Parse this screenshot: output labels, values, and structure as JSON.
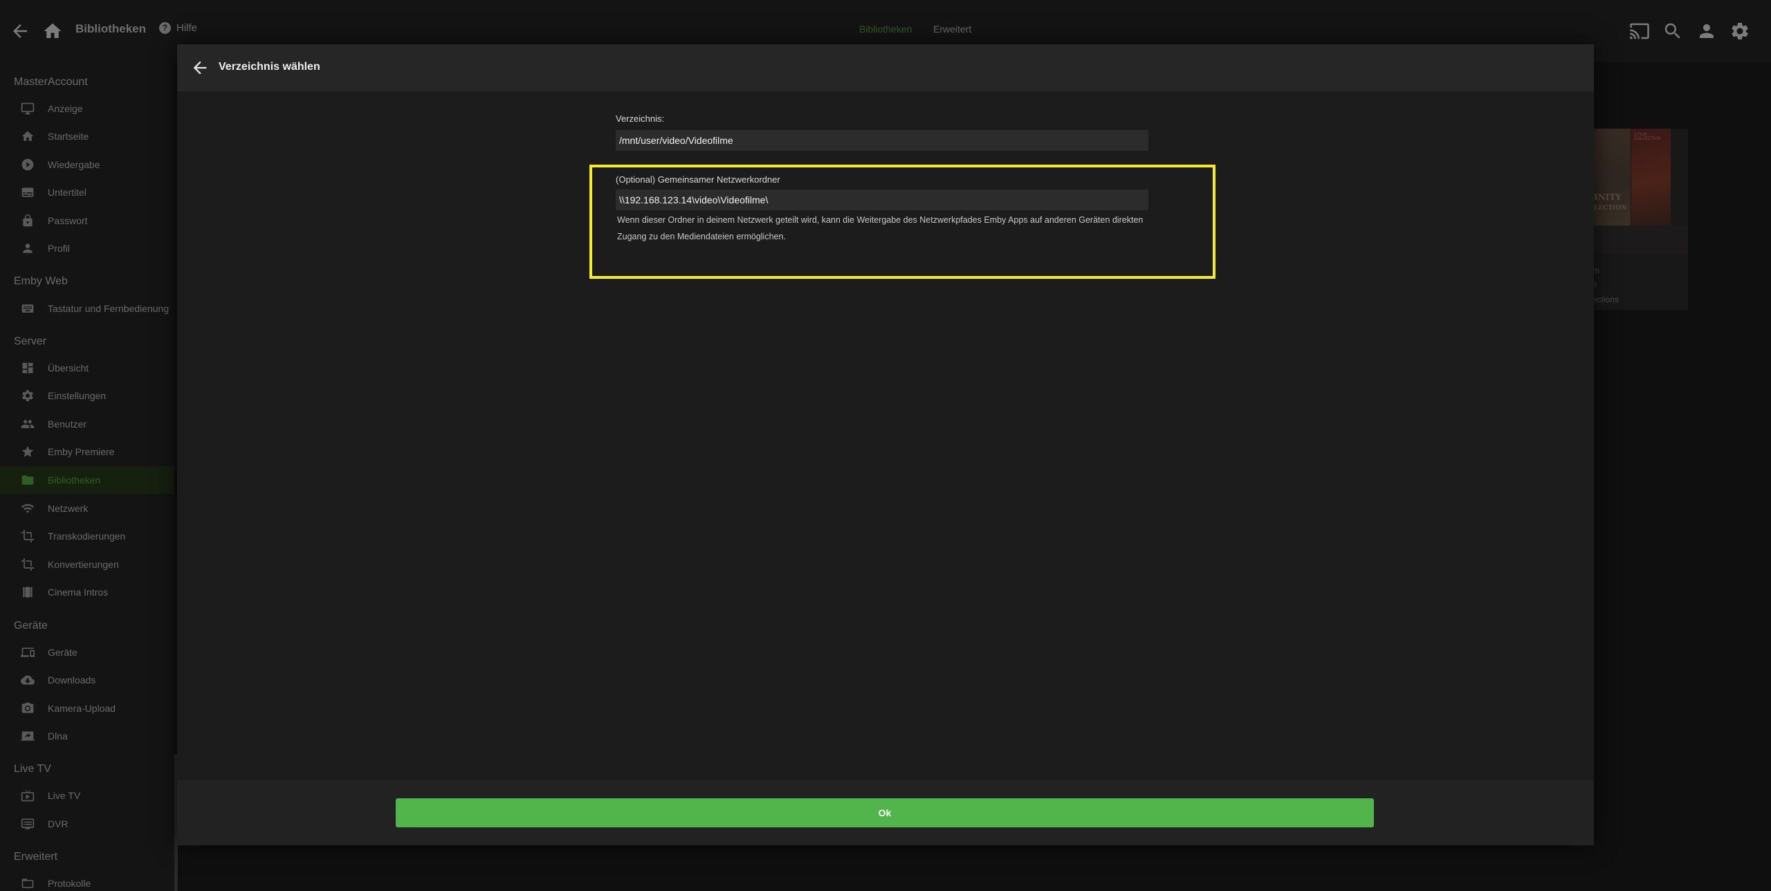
{
  "topbar": {
    "title": "Bibliotheken",
    "help_icon_glyph": "?",
    "help_label": "Hilfe",
    "tabs": [
      {
        "label": "Bibliotheken",
        "active": true
      },
      {
        "label": "Erweitert",
        "active": false
      }
    ],
    "icons": [
      "back-arrow-icon",
      "home-icon",
      "cast-icon",
      "search-icon",
      "user-icon",
      "settings-gear-icon"
    ]
  },
  "sidebar": {
    "sections": [
      {
        "title": "MasterAccount",
        "items": [
          {
            "label": "Anzeige",
            "icon": "monitor-icon"
          },
          {
            "label": "Startseite",
            "icon": "home-icon"
          },
          {
            "label": "Wiedergabe",
            "icon": "play-circle-icon"
          },
          {
            "label": "Untertitel",
            "icon": "subtitles-icon"
          },
          {
            "label": "Passwort",
            "icon": "lock-icon"
          },
          {
            "label": "Profil",
            "icon": "person-icon"
          }
        ]
      },
      {
        "title": "Emby Web",
        "items": [
          {
            "label": "Tastatur und Fernbedienung",
            "icon": "keyboard-icon"
          }
        ]
      },
      {
        "title": "Server",
        "items": [
          {
            "label": "Übersicht",
            "icon": "dashboard-icon"
          },
          {
            "label": "Einstellungen",
            "icon": "gear-icon"
          },
          {
            "label": "Benutzer",
            "icon": "people-icon"
          },
          {
            "label": "Emby Premiere",
            "icon": "star-icon"
          },
          {
            "label": "Bibliotheken",
            "icon": "folder-icon",
            "active": true
          },
          {
            "label": "Netzwerk",
            "icon": "wifi-icon"
          },
          {
            "label": "Transkodierungen",
            "icon": "crop-icon"
          },
          {
            "label": "Konvertierungen",
            "icon": "crop-icon"
          },
          {
            "label": "Cinema Intros",
            "icon": "film-icon"
          }
        ]
      },
      {
        "title": "Geräte",
        "items": [
          {
            "label": "Geräte",
            "icon": "devices-icon"
          },
          {
            "label": "Downloads",
            "icon": "cloud-download-icon"
          },
          {
            "label": "Kamera-Upload",
            "icon": "camera-icon"
          },
          {
            "label": "Dlna",
            "icon": "screen-share-icon"
          }
        ]
      },
      {
        "title": "Live TV",
        "items": [
          {
            "label": "Live TV",
            "icon": "live-tv-icon"
          },
          {
            "label": "DVR",
            "icon": "dvr-icon"
          }
        ]
      },
      {
        "title": "Erweitert",
        "items": [
          {
            "label": "Protokolle",
            "icon": "folder-icon"
          }
        ]
      }
    ]
  },
  "background": {
    "poster_text_1": "INITY",
    "poster_text_1b": "LECTION",
    "poster_text_2": "2 FILM COLLECTION",
    "card_lines": [
      "m",
      "e",
      "ections"
    ]
  },
  "modal": {
    "title": "Verzeichnis wählen",
    "directory_label": "Verzeichnis:",
    "directory_value": "/mnt/user/video/Videofilme",
    "network_label": "(Optional) Gemeinsamer Netzwerkordner",
    "network_value": "\\\\192.168.123.14\\video\\Videofilme\\",
    "network_help": "Wenn dieser Ordner in deinem Netzwerk geteilt wird, kann die Weitergabe des Netzwerkpfades Emby Apps auf anderen Geräten direkten Zugang zu den Mediendateien ermöglichen.",
    "ok_label": "Ok",
    "highlight_color": "#f7ec1c",
    "ok_color": "#52b54b"
  }
}
